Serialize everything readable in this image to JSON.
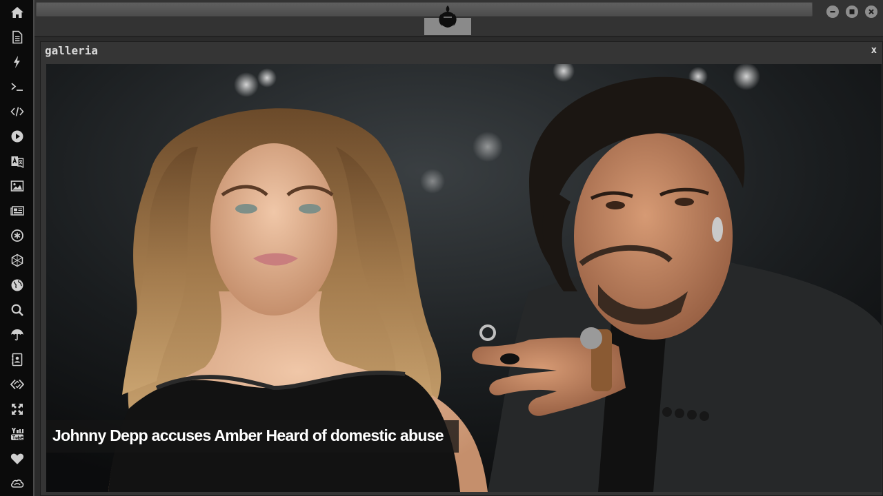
{
  "sidebar": {
    "items": [
      {
        "icon": "home-icon"
      },
      {
        "icon": "document-icon"
      },
      {
        "icon": "lightning-icon"
      },
      {
        "icon": "terminal-icon"
      },
      {
        "icon": "code-icon"
      },
      {
        "icon": "play-icon"
      },
      {
        "icon": "translate-icon"
      },
      {
        "icon": "image-icon"
      },
      {
        "icon": "newspaper-icon"
      },
      {
        "icon": "asterisk-circle-icon"
      },
      {
        "icon": "hexagon-icon"
      },
      {
        "icon": "globe-icon"
      },
      {
        "icon": "search-icon"
      },
      {
        "icon": "umbrella-icon"
      },
      {
        "icon": "contacts-icon"
      },
      {
        "icon": "code-link-icon"
      },
      {
        "icon": "expand-icon"
      },
      {
        "icon": "youtube-icon"
      },
      {
        "icon": "heart-icon"
      },
      {
        "icon": "cloud-icon"
      }
    ]
  },
  "topbar": {
    "address_value": "",
    "logo": "rebel-alliance-logo",
    "window_controls": [
      "minimize-icon",
      "maximize-icon",
      "close-icon"
    ]
  },
  "window": {
    "title": "galleria",
    "close_label": "x"
  },
  "gallery": {
    "caption": "Johnny Depp accuses Amber Heard of domestic abuse"
  },
  "colors": {
    "sidebar_bg": "#0b0b0b",
    "topbar_bg": "#333333",
    "window_bg": "#353535",
    "caption_bg": "#141414"
  }
}
